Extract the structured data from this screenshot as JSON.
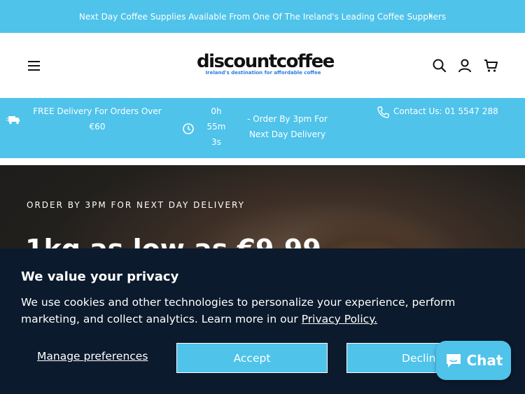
{
  "announcement": {
    "text": "Next Day Coffee Supplies Available From One Of The Ireland's Leading Coffee Suppliers",
    "chevron": "›"
  },
  "header": {
    "logo_name": "discountcoffee",
    "logo_tagline": "Ireland's destination for affordable coffee",
    "icons": [
      "menu-icon",
      "search-icon",
      "account-icon",
      "cart-icon"
    ]
  },
  "usp": {
    "free_delivery": "FREE Delivery For Orders Over €60",
    "countdown_h": "0h",
    "countdown_m": "55m",
    "countdown_s": "3s",
    "order_by": "- Order By 3pm For Next Day Delivery",
    "contact": "Contact Us: 01 5547 288"
  },
  "hero": {
    "eyebrow": "ORDER BY 3PM FOR NEXT DAY DELIVERY",
    "headline": "1kg as low as €9.99"
  },
  "consent": {
    "title": "We value your privacy",
    "description": "We use cookies and other technologies to personalize your experience, perform marketing, and collect analytics. Learn more in our",
    "policy_link": "Privacy Policy.",
    "manage_label": "Manage preferences",
    "accept_label": "Accept",
    "decline_label": "Decline"
  },
  "chat": {
    "label": "Chat"
  },
  "colors": {
    "accent": "#4fc3ea",
    "consent_bg": "#0b1a2c",
    "hero_bg": "#1c1b1a"
  }
}
